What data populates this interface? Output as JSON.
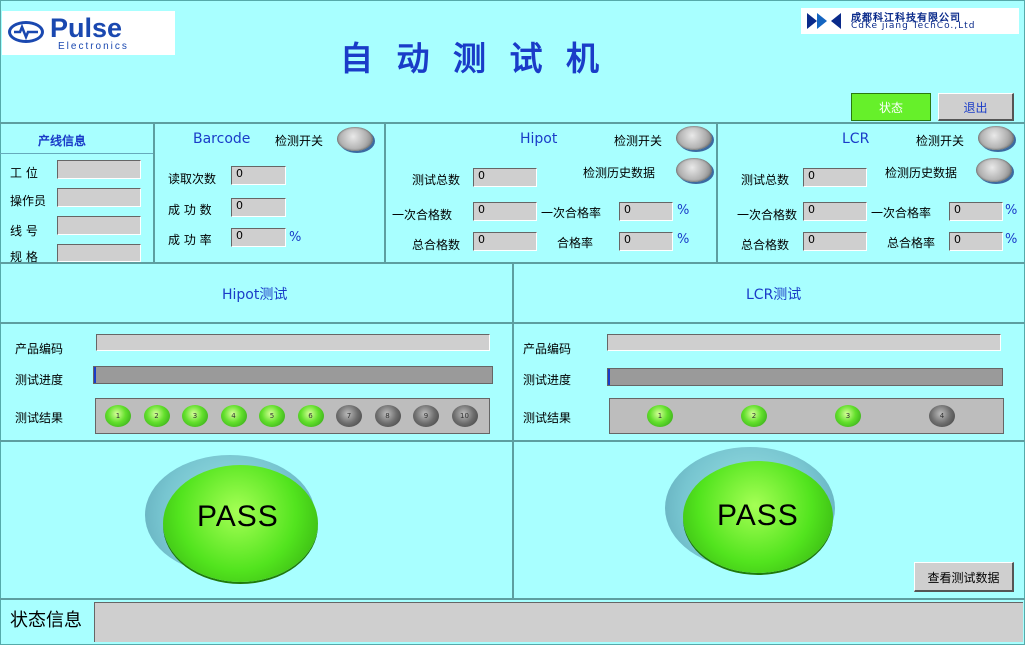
{
  "header": {
    "logo_brand": "Pulse",
    "logo_sub": "Electronics",
    "title": "自 动 测 试 机",
    "company_cn": "成都科江科技有限公司",
    "company_en": "CdKe jiang TechCo.,Ltd",
    "status_button": "状态",
    "exit_button": "退出"
  },
  "line_info": {
    "title": "产线信息",
    "fields": [
      {
        "label": "工  位",
        "value": ""
      },
      {
        "label": "操作员",
        "value": ""
      },
      {
        "label": "线  号",
        "value": ""
      },
      {
        "label": "规  格",
        "value": ""
      }
    ]
  },
  "barcode": {
    "title": "Barcode",
    "switch_label": "检测开关",
    "rows": [
      {
        "label": "读取次数",
        "value": "0"
      },
      {
        "label": "成 功 数",
        "value": "0"
      },
      {
        "label": "成 功 率",
        "value": "0",
        "unit": "%"
      }
    ]
  },
  "hipot_stats": {
    "title": "Hipot",
    "switch_label": "检测开关",
    "history_label": "检测历史数据",
    "total_label": "测试总数",
    "total_value": "0",
    "first_pass_label": "一次合格数",
    "first_pass_value": "0",
    "first_rate_label": "一次合格率",
    "first_rate_value": "0",
    "first_rate_unit": "%",
    "total_pass_label": "总合格数",
    "total_pass_value": "0",
    "rate_label": "合格率",
    "rate_value": "0",
    "rate_unit": "%"
  },
  "lcr_stats": {
    "title": "LCR",
    "switch_label": "检测开关",
    "history_label": "检测历史数据",
    "total_label": "测试总数",
    "total_value": "0",
    "first_pass_label": "一次合格数",
    "first_pass_value": "0",
    "first_rate_label": "一次合格率",
    "first_rate_value": "0",
    "first_rate_unit": "%",
    "total_pass_label": "总合格数",
    "total_pass_value": "0",
    "rate_label": "总合格率",
    "rate_value": "0",
    "rate_unit": "%"
  },
  "hipot_test": {
    "title": "Hipot测试",
    "product_code_label": "产品编码",
    "progress_label": "测试进度",
    "result_label": "测试结果",
    "progress": 0,
    "leds": [
      {
        "n": "1",
        "state": "on"
      },
      {
        "n": "2",
        "state": "on"
      },
      {
        "n": "3",
        "state": "on"
      },
      {
        "n": "4",
        "state": "on"
      },
      {
        "n": "5",
        "state": "on"
      },
      {
        "n": "6",
        "state": "on"
      },
      {
        "n": "7",
        "state": "off"
      },
      {
        "n": "8",
        "state": "off"
      },
      {
        "n": "9",
        "state": "off"
      },
      {
        "n": "10",
        "state": "off"
      }
    ],
    "result": "PASS"
  },
  "lcr_test": {
    "title": "LCR测试",
    "product_code_label": "产品编码",
    "progress_label": "测试进度",
    "result_label": "测试结果",
    "progress": 0,
    "leds": [
      {
        "n": "1",
        "state": "on"
      },
      {
        "n": "2",
        "state": "on"
      },
      {
        "n": "3",
        "state": "on"
      },
      {
        "n": "4",
        "state": "off"
      }
    ],
    "result": "PASS",
    "view_data_button": "查看测试数据"
  },
  "status_bar": {
    "label": "状态信息",
    "message": ""
  },
  "colors": {
    "background": "#a8ffff",
    "accent_blue": "#1a3cc8",
    "status_button_green": "#66f02a",
    "pass_green": "#52e41e"
  }
}
